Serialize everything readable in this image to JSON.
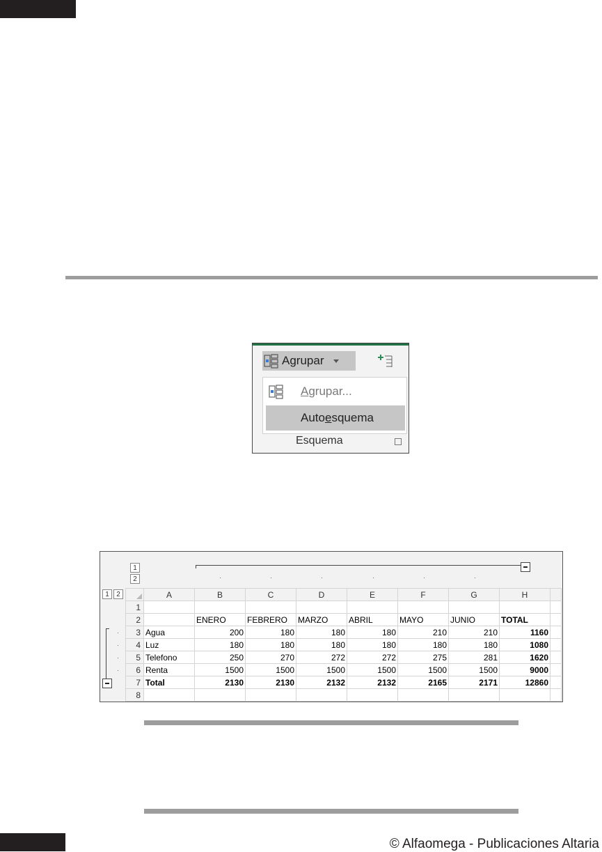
{
  "footer": {
    "text": "© Alfaomega - Publicaciones Altaria"
  },
  "ribbon": {
    "button_label": "Agrupar",
    "menu": {
      "item1": {
        "text": "Agrupar...",
        "underline": "A",
        "rest": "grupar..."
      },
      "item2": {
        "text": "Autoesquema",
        "pre": "Auto",
        "underline": "e",
        "rest": "squema"
      }
    },
    "group_label": "Esquema",
    "accent": "#217346"
  },
  "sheet": {
    "outline_levels_cols": [
      "1",
      "2"
    ],
    "outline_levels_rows": [
      "1",
      "2"
    ],
    "columns": [
      "A",
      "B",
      "C",
      "D",
      "E",
      "F",
      "G",
      "H"
    ],
    "rows": [
      {
        "num": "1",
        "cells": [
          "",
          "",
          "",
          "",
          "",
          "",
          "",
          ""
        ]
      },
      {
        "num": "2",
        "cells": [
          "",
          "ENERO",
          "FEBRERO",
          "MARZO",
          "ABRIL",
          "MAYO",
          "JUNIO",
          "TOTAL"
        ]
      },
      {
        "num": "3",
        "cells": [
          "Agua",
          "200",
          "180",
          "180",
          "180",
          "210",
          "210",
          "1160"
        ]
      },
      {
        "num": "4",
        "cells": [
          "Luz",
          "180",
          "180",
          "180",
          "180",
          "180",
          "180",
          "1080"
        ]
      },
      {
        "num": "5",
        "cells": [
          "Telefono",
          "250",
          "270",
          "272",
          "272",
          "275",
          "281",
          "1620"
        ]
      },
      {
        "num": "6",
        "cells": [
          "Renta",
          "1500",
          "1500",
          "1500",
          "1500",
          "1500",
          "1500",
          "9000"
        ]
      },
      {
        "num": "7",
        "cells": [
          "Total",
          "2130",
          "2130",
          "2132",
          "2132",
          "2165",
          "2171",
          "12860"
        ]
      },
      {
        "num": "8",
        "cells": [
          "",
          "",
          "",
          "",
          "",
          "",
          "",
          ""
        ]
      }
    ]
  }
}
